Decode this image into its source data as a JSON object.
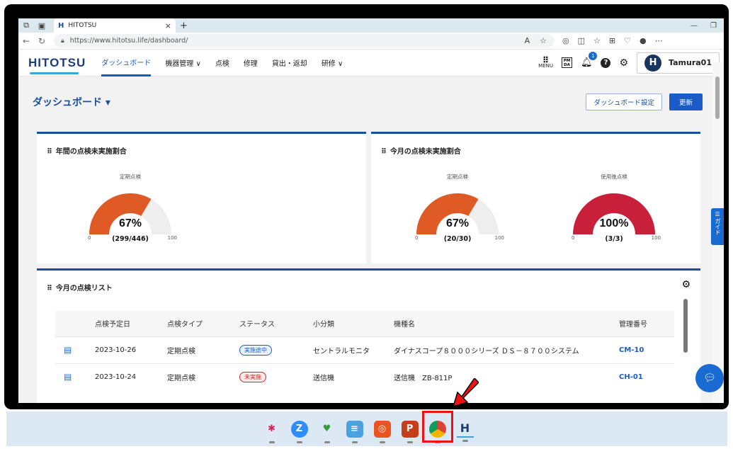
{
  "browser": {
    "tab_favicon": "H",
    "tab_title": "HITOTSU",
    "tab_close": "×",
    "new_tab": "+",
    "url": "https://www.hitotsu.life/dashboard/",
    "minimize": "—",
    "restore": "❐"
  },
  "header": {
    "logo": "HITOTSU",
    "nav": [
      "ダッシュボード",
      "機器管理 ∨",
      "点検",
      "修理",
      "貸出・返却",
      "研修 ∨"
    ],
    "menu_label": "MENU",
    "pm_label": "PM DA",
    "bell_badge": "1",
    "help": "?",
    "avatar": "H",
    "username": "Tamura01"
  },
  "dashboard": {
    "title": "ダッシュボード ▾",
    "settings_button": "ダッシュボード設定",
    "refresh_button": "更新"
  },
  "cards": {
    "annual": {
      "title": "年間の点検未実施割合",
      "gauges": [
        {
          "label": "定期点検",
          "percent": "67%",
          "count": "(299/446)",
          "min": "0",
          "max": "100",
          "value": 67,
          "color": "#e05a25"
        }
      ]
    },
    "monthly": {
      "title": "今月の点検未実施割合",
      "gauges": [
        {
          "label": "定期点検",
          "percent": "67%",
          "count": "(20/30)",
          "min": "0",
          "max": "100",
          "value": 67,
          "color": "#e05a25"
        },
        {
          "label": "使用後点検",
          "percent": "100%",
          "count": "(3/3)",
          "min": "0",
          "max": "100",
          "value": 100,
          "color": "#c8203a"
        }
      ]
    },
    "list": {
      "title": "今月の点検リスト",
      "columns": [
        "",
        "点検予定日",
        "点検タイプ",
        "ステータス",
        "小分類",
        "機種名",
        "管理番号"
      ],
      "rows": [
        {
          "date": "2023-10-26",
          "type": "定期点検",
          "status": "実施途中",
          "status_kind": "blue",
          "category": "セントラルモニタ",
          "model": "ダイナスコープ８０００シリーズ ＤＳ－８７００システム",
          "code": "CM-10"
        },
        {
          "date": "2023-10-24",
          "type": "定期点検",
          "status": "未実施",
          "status_kind": "red",
          "category": "送信機",
          "model": "送信機　ZB-811P",
          "code": "CH-01"
        }
      ]
    }
  },
  "side": {
    "guide": "ガイド"
  },
  "taskbar": {
    "items": [
      "slack-icon",
      "zoom-icon",
      "app-icon",
      "notepad-icon",
      "ubuntu-icon",
      "powerpoint-icon",
      "chrome-icon",
      "hitotsu-icon"
    ],
    "hitotsu_label": "H"
  }
}
